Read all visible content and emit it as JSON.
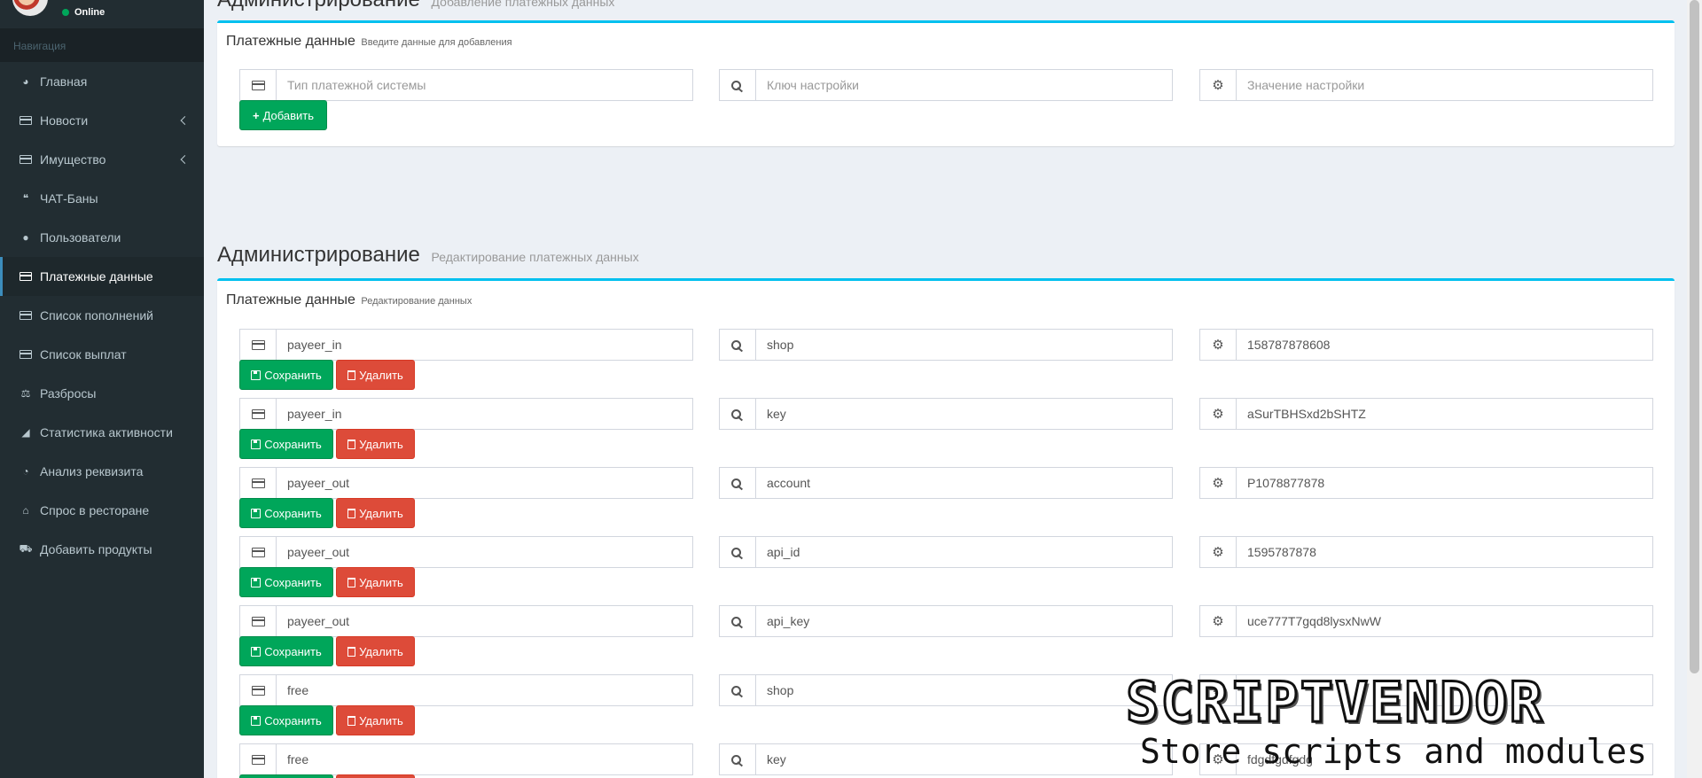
{
  "sidebar": {
    "status": "Online",
    "nav_header": "Навигация",
    "items": [
      {
        "label": "Главная"
      },
      {
        "label": "Новости"
      },
      {
        "label": "Имущество"
      },
      {
        "label": "ЧАТ-Баны"
      },
      {
        "label": "Пользователи"
      },
      {
        "label": "Платежные данные"
      },
      {
        "label": "Список пополнений"
      },
      {
        "label": "Список выплат"
      },
      {
        "label": "Разбросы"
      },
      {
        "label": "Статистика активности"
      },
      {
        "label": "Анализ реквизита"
      },
      {
        "label": "Спрос в ресторане"
      },
      {
        "label": "Добавить продукты"
      }
    ]
  },
  "add_section": {
    "header_title": "Администрирование",
    "header_subtitle": "Добавление платежных данных",
    "box_title": "Платежные данные",
    "box_subtitle": "Введите данные для добавления",
    "type_placeholder": "Тип платежной системы",
    "key_placeholder": "Ключ настройки",
    "value_placeholder": "Значение настройки",
    "add_label": "Добавить"
  },
  "edit_section": {
    "header_title": "Администрирование",
    "header_subtitle": "Редактирование платежных данных",
    "box_title": "Платежные данные",
    "box_subtitle": "Редактирование данных",
    "save_label": "Сохранить",
    "delete_label": "Удалить",
    "rows": [
      {
        "type": "payeer_in",
        "key": "shop",
        "value": "158787878608"
      },
      {
        "type": "payeer_in",
        "key": "key",
        "value": "aSurTBHSxd2bSHTZ"
      },
      {
        "type": "payeer_out",
        "key": "account",
        "value": "P1078877878"
      },
      {
        "type": "payeer_out",
        "key": "api_id",
        "value": "1595787878"
      },
      {
        "type": "payeer_out",
        "key": "api_key",
        "value": "uce777T7gqd8lysxNwW"
      },
      {
        "type": "free",
        "key": "shop",
        "value": ""
      },
      {
        "type": "free",
        "key": "key",
        "value": "fdgdfgdfgdg"
      }
    ]
  },
  "watermark": {
    "title": "SCRIPTVENDOR",
    "subtitle": "Store scripts and modules"
  },
  "colors": {
    "sidebar_bg": "#222d32",
    "accent": "#00c0ef",
    "success": "#00a65a",
    "danger": "#dd4b39",
    "online": "#00a65a"
  }
}
